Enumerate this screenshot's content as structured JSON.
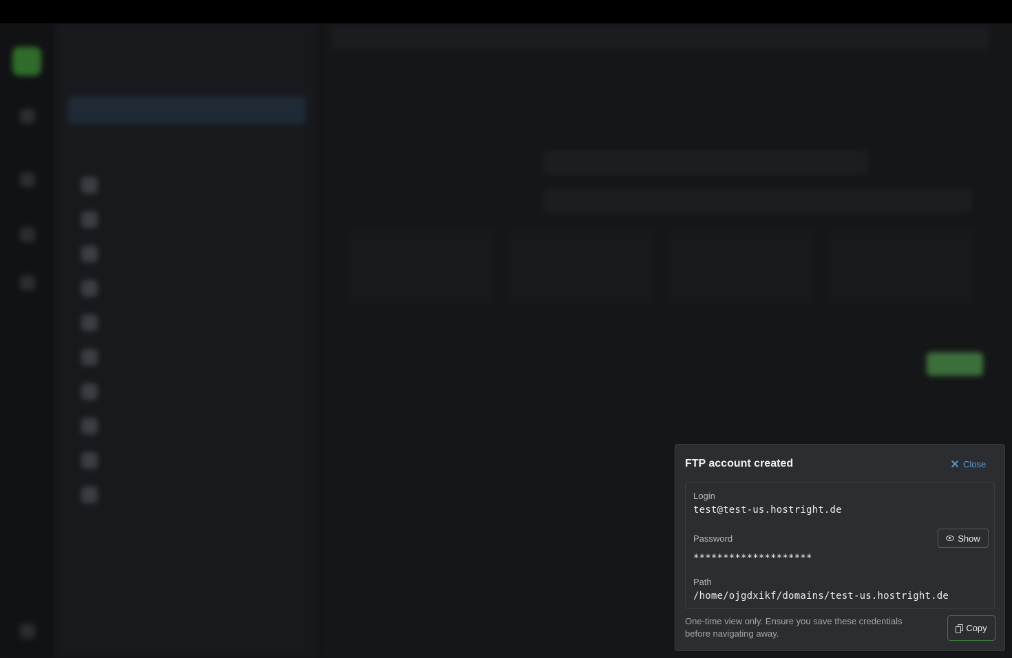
{
  "toast": {
    "title": "FTP account created",
    "close_label": "Close",
    "login_label": "Login",
    "login_value": "test@test-us.hostright.de",
    "password_label": "Password",
    "password_value": "********************",
    "show_label": "Show",
    "path_label": "Path",
    "path_value": "/home/ojgdxikf/domains/test-us.hostright.de",
    "note": "One-time view only. Ensure you save these credentials before navigating away.",
    "copy_label": "Copy"
  },
  "icons": [
    "close-icon",
    "eye-icon",
    "copy-icon"
  ],
  "colors": {
    "link": "#5b9bd5",
    "copy_border": "#3f7a3c",
    "toast_bg": "#2c2d30"
  }
}
